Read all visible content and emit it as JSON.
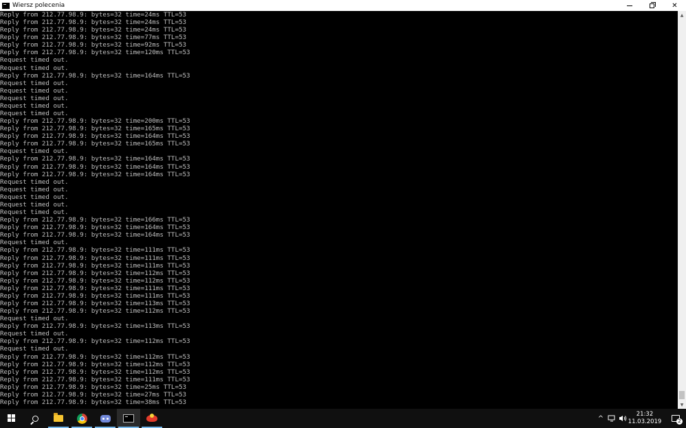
{
  "window": {
    "title": "Wiersz polecenia",
    "minimize_symbol": "",
    "close_symbol": "✕"
  },
  "console": {
    "lines": [
      "Reply from 212.77.98.9: bytes=32 time=24ms TTL=53",
      "Reply from 212.77.98.9: bytes=32 time=24ms TTL=53",
      "Reply from 212.77.98.9: bytes=32 time=24ms TTL=53",
      "Reply from 212.77.98.9: bytes=32 time=77ms TTL=53",
      "Reply from 212.77.98.9: bytes=32 time=92ms TTL=53",
      "Reply from 212.77.98.9: bytes=32 time=120ms TTL=53",
      "Request timed out.",
      "Request timed out.",
      "Reply from 212.77.98.9: bytes=32 time=164ms TTL=53",
      "Request timed out.",
      "Request timed out.",
      "Request timed out.",
      "Request timed out.",
      "Request timed out.",
      "Reply from 212.77.98.9: bytes=32 time=200ms TTL=53",
      "Reply from 212.77.98.9: bytes=32 time=165ms TTL=53",
      "Reply from 212.77.98.9: bytes=32 time=164ms TTL=53",
      "Reply from 212.77.98.9: bytes=32 time=165ms TTL=53",
      "Request timed out.",
      "Reply from 212.77.98.9: bytes=32 time=164ms TTL=53",
      "Reply from 212.77.98.9: bytes=32 time=164ms TTL=53",
      "Reply from 212.77.98.9: bytes=32 time=164ms TTL=53",
      "Request timed out.",
      "Request timed out.",
      "Request timed out.",
      "Request timed out.",
      "Request timed out.",
      "Reply from 212.77.98.9: bytes=32 time=166ms TTL=53",
      "Reply from 212.77.98.9: bytes=32 time=164ms TTL=53",
      "Reply from 212.77.98.9: bytes=32 time=164ms TTL=53",
      "Request timed out.",
      "Reply from 212.77.98.9: bytes=32 time=111ms TTL=53",
      "Reply from 212.77.98.9: bytes=32 time=111ms TTL=53",
      "Reply from 212.77.98.9: bytes=32 time=111ms TTL=53",
      "Reply from 212.77.98.9: bytes=32 time=112ms TTL=53",
      "Reply from 212.77.98.9: bytes=32 time=112ms TTL=53",
      "Reply from 212.77.98.9: bytes=32 time=111ms TTL=53",
      "Reply from 212.77.98.9: bytes=32 time=111ms TTL=53",
      "Reply from 212.77.98.9: bytes=32 time=113ms TTL=53",
      "Reply from 212.77.98.9: bytes=32 time=112ms TTL=53",
      "Request timed out.",
      "Reply from 212.77.98.9: bytes=32 time=113ms TTL=53",
      "Request timed out.",
      "Reply from 212.77.98.9: bytes=32 time=112ms TTL=53",
      "Request timed out.",
      "Reply from 212.77.98.9: bytes=32 time=112ms TTL=53",
      "Reply from 212.77.98.9: bytes=32 time=112ms TTL=53",
      "Reply from 212.77.98.9: bytes=32 time=112ms TTL=53",
      "Reply from 212.77.98.9: bytes=32 time=111ms TTL=53",
      "Reply from 212.77.98.9: bytes=32 time=25ms TTL=53",
      "Reply from 212.77.98.9: bytes=32 time=27ms TTL=53",
      "Reply from 212.77.98.9: bytes=32 time=38ms TTL=53"
    ],
    "text_color": "#c0c0c0",
    "background": "#000000"
  },
  "taskbar": {
    "apps": [
      {
        "name": "start-button",
        "icon": "windows-icon"
      },
      {
        "name": "search-button",
        "icon": "search-icon"
      },
      {
        "name": "file-explorer",
        "icon": "folder-icon"
      },
      {
        "name": "chrome",
        "icon": "chrome-icon"
      },
      {
        "name": "discord",
        "icon": "discord-icon"
      },
      {
        "name": "command-prompt",
        "icon": "cmd-icon",
        "active": true
      },
      {
        "name": "game",
        "icon": "game-icon"
      }
    ],
    "tray": {
      "chevron": "^",
      "time": "21:32",
      "date": "11.03.2019",
      "notification_count": "2"
    },
    "accent": "#76b9ed"
  }
}
